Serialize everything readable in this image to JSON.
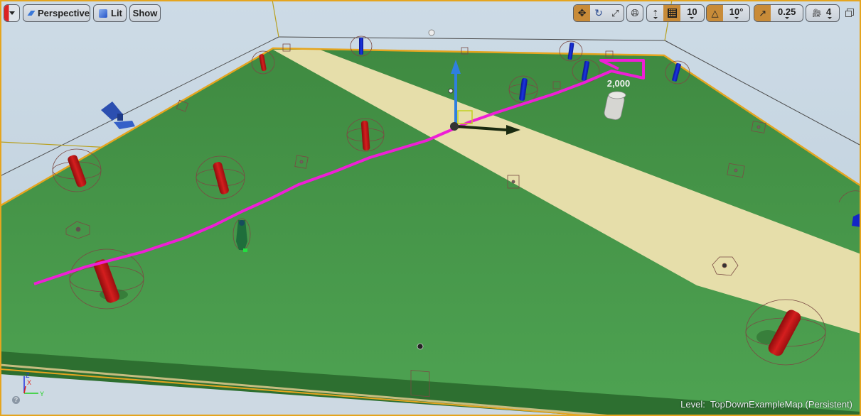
{
  "viewport": {
    "toolbar_left": {
      "options_menu_icon": "dropdown-caret-icon",
      "view_mode_label": "Perspective",
      "view_mode_icon": "perspective-plane-icon",
      "lighting_label": "Lit",
      "lighting_icon": "lit-cube-icon",
      "show_label": "Show"
    },
    "toolbar_right": {
      "transform_tools": [
        {
          "name": "translate",
          "icon": "translate-arrows-icon",
          "active": true
        },
        {
          "name": "rotate",
          "icon": "rotate-icon",
          "active": false
        },
        {
          "name": "scale",
          "icon": "scale-icon",
          "active": false
        }
      ],
      "coordinate_space_icon": "world-globe-icon",
      "surface_snapping_icon": "surface-snap-icon",
      "grid_snap": {
        "icon": "grid-icon",
        "active": true,
        "value": "10"
      },
      "rotation_snap": {
        "icon": "angle-icon",
        "active": true,
        "value": "10°"
      },
      "scale_snap": {
        "icon": "scale-arrow-icon",
        "active": true,
        "value": "0.25"
      },
      "camera_speed": {
        "icon": "camera-speed-icon",
        "value": "4"
      },
      "maximize_icon": "restore-window-icon"
    },
    "scene": {
      "floating_text": "2,000",
      "colors": {
        "floor_green": "#4a9a4c",
        "path_sand": "#e6deaa",
        "nav_path_magenta": "#ee1fd6",
        "selection_orange": "#e5a51f",
        "red_cylinder": "#c81a1a",
        "blue_cylinder": "#1326c8"
      }
    },
    "axis_indicator": {
      "z": "Z",
      "x": "X",
      "y": "Y"
    },
    "help_icon": "?",
    "level_prefix": "Level:",
    "level_name": "TopDownExampleMap (Persistent)"
  }
}
